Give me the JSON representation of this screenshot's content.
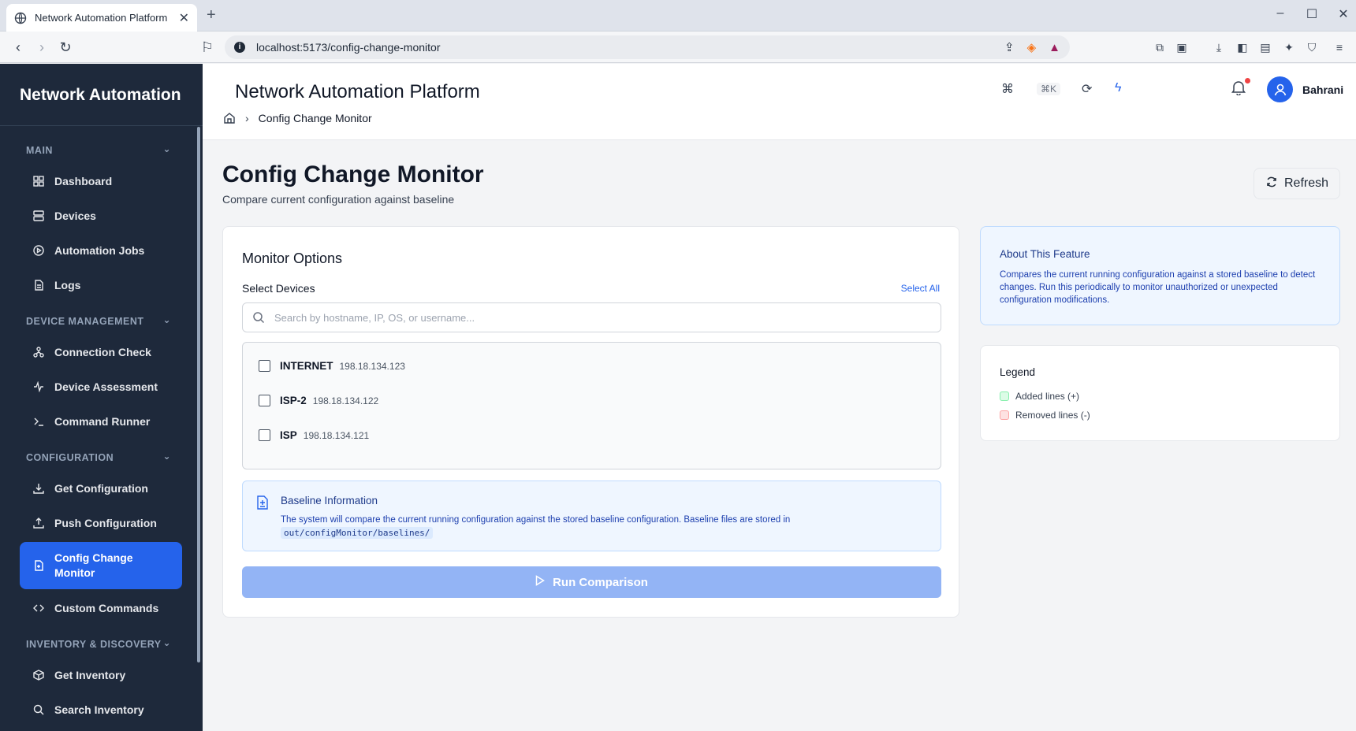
{
  "browser": {
    "tab_title": "Network Automation Platform",
    "url": "localhost:5173/config-change-monitor"
  },
  "sidebar": {
    "brand": "Network Automation",
    "sections": [
      {
        "label": "MAIN",
        "items": [
          "Dashboard",
          "Devices",
          "Automation Jobs",
          "Logs"
        ]
      },
      {
        "label": "DEVICE MANAGEMENT",
        "items": [
          "Connection Check",
          "Device Assessment",
          "Command Runner"
        ]
      },
      {
        "label": "CONFIGURATION",
        "items": [
          "Get Configuration",
          "Push Configuration",
          "Config Change Monitor",
          "Custom Commands"
        ]
      },
      {
        "label": "INVENTORY & DISCOVERY",
        "items": [
          "Get Inventory",
          "Search Inventory"
        ]
      }
    ],
    "active_item": "Config Change Monitor",
    "active_line1": "Config Change",
    "active_line2": "Monitor"
  },
  "header": {
    "title": "Network Automation Platform",
    "breadcrumb_current": "Config Change Monitor",
    "shortcut": "⌘K",
    "user_name": "Bahrani"
  },
  "page": {
    "title": "Config Change Monitor",
    "subtitle": "Compare current configuration against baseline",
    "refresh_label": "Refresh"
  },
  "monitor": {
    "title": "Monitor Options",
    "select_label": "Select Devices",
    "select_all": "Select All",
    "search_placeholder": "Search by hostname, IP, OS, or username...",
    "devices": [
      {
        "name": "INTERNET",
        "ip": "198.18.134.123",
        "checked": false
      },
      {
        "name": "ISP-2",
        "ip": "198.18.134.122",
        "checked": false
      },
      {
        "name": "ISP",
        "ip": "198.18.134.121",
        "checked": false
      }
    ],
    "baseline_title": "Baseline Information",
    "baseline_text": "The system will compare the current running configuration against the stored baseline configuration. Baseline files are stored in",
    "baseline_path": "out/configMonitor/baselines/",
    "run_label": "Run Comparison"
  },
  "about": {
    "title": "About This Feature",
    "text": "Compares the current running configuration against a stored baseline to detect changes. Run this periodically to monitor unauthorized or unexpected configuration modifications."
  },
  "legend": {
    "title": "Legend",
    "added": "Added lines (+)",
    "removed": "Removed lines (-)",
    "added_color": "#dcfce7",
    "removed_color": "#fee2e2"
  }
}
